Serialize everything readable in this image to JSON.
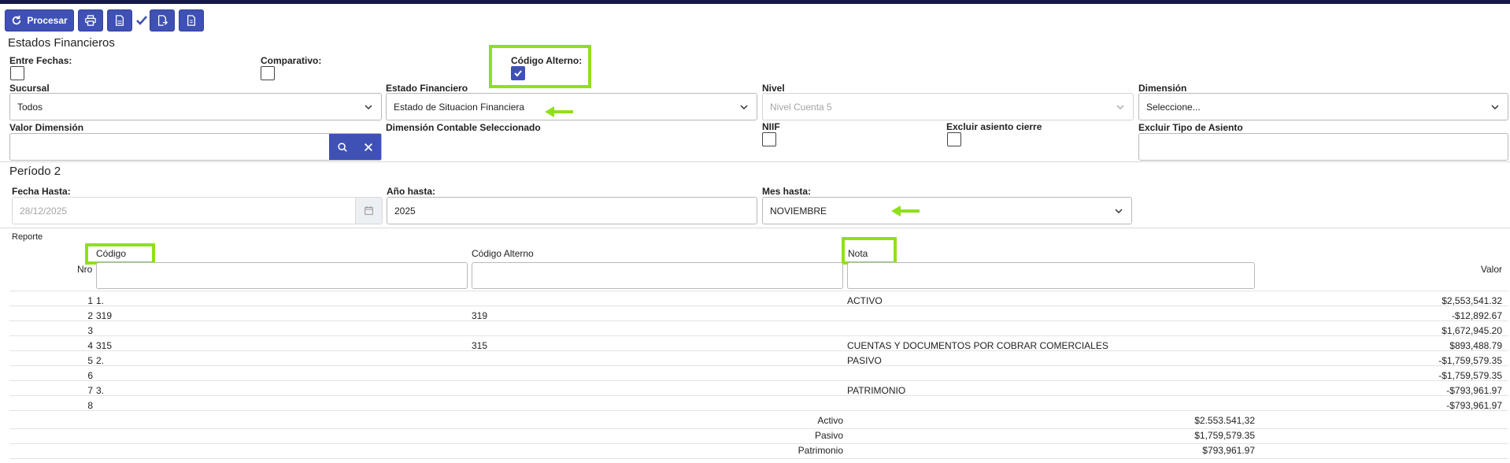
{
  "toolbar": {
    "procesar_label": "Procesar",
    "icons": [
      "refresh-icon",
      "print-icon",
      "pdf-icon",
      "check-icon",
      "export-icon",
      "file-icon"
    ]
  },
  "page_title": "Estados Financieros",
  "filters": {
    "entre_fechas_label": "Entre Fechas:",
    "comparativo_label": "Comparativo:",
    "codigo_alterno_label": "Código Alterno:",
    "codigo_alterno_checked": true,
    "sucursal_label": "Sucursal",
    "sucursal_value": "Todos",
    "estado_label": "Estado Financiero",
    "estado_value": "Estado de Situacion Financiera",
    "nivel_label": "Nivel",
    "nivel_value": "Nivel Cuenta 5",
    "dimension_label": "Dimensión",
    "dimension_value": "Seleccione...",
    "valor_dimension_label": "Valor Dimensión",
    "dimension_contable_label": "Dimensión Contable Seleccionado",
    "niif_label": "NIIF",
    "excluir_cierre_label": "Excluir asiento cierre",
    "excluir_tipo_label": "Excluir Tipo de Asiento"
  },
  "periodo": {
    "title": "Período 2",
    "fecha_hasta_label": "Fecha Hasta:",
    "fecha_hasta_value": "28/12/2025",
    "anio_label": "Año hasta:",
    "anio_value": "2025",
    "mes_label": "Mes hasta:",
    "mes_value": "NOVIEMBRE"
  },
  "report": {
    "title": "Reporte",
    "columns": {
      "nro": "Nro",
      "codigo": "Código",
      "codigo_alterno": "Código Alterno",
      "nota": "Nota",
      "valor": "Valor"
    },
    "rows": [
      {
        "nro": "1",
        "codigo": "1.",
        "alterno": "",
        "nota": "ACTIVO",
        "valor": "$2,553,541.32"
      },
      {
        "nro": "2",
        "codigo": "319",
        "alterno": "319",
        "nota": "",
        "valor": "-$12,892.67"
      },
      {
        "nro": "3",
        "codigo": "",
        "alterno": "",
        "nota": "",
        "valor": "$1,672,945.20"
      },
      {
        "nro": "4",
        "codigo": "315",
        "alterno": "315",
        "nota": "CUENTAS Y DOCUMENTOS POR COBRAR COMERCIALES",
        "valor": "$893,488.79"
      },
      {
        "nro": "5",
        "codigo": "2.",
        "alterno": "",
        "nota": "PASIVO",
        "valor": "-$1,759,579.35"
      },
      {
        "nro": "6",
        "codigo": "",
        "alterno": "",
        "nota": "",
        "valor": "-$1,759,579.35"
      },
      {
        "nro": "7",
        "codigo": "3.",
        "alterno": "",
        "nota": "PATRIMONIO",
        "valor": "-$793,961.97"
      },
      {
        "nro": "8",
        "codigo": "",
        "alterno": "",
        "nota": "",
        "valor": "-$793,961.97"
      }
    ],
    "totals": [
      {
        "label": "Activo",
        "value": "$2.553.541,32"
      },
      {
        "label": "Pasivo",
        "value": "$1,759,579.35"
      },
      {
        "label": "Patrimonio",
        "value": "$793,961.97"
      }
    ]
  },
  "colors": {
    "primary": "#3f51b5",
    "highlight": "#8fe01c",
    "topbar": "#161a4a"
  }
}
